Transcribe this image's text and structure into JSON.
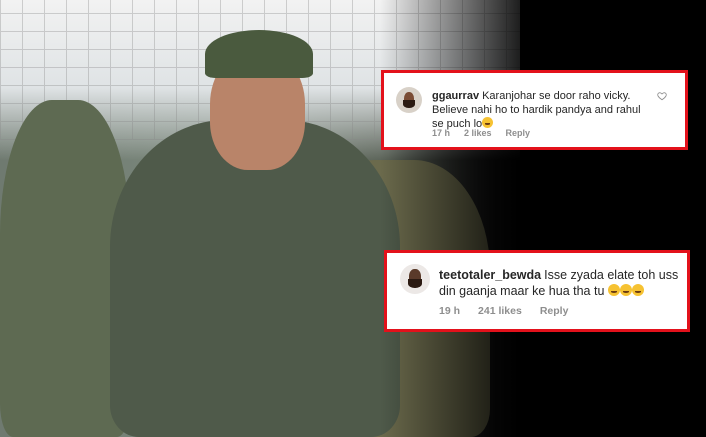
{
  "comments": [
    {
      "username": "ggaurrav",
      "text_line1": "Karanjohar se door raho vicky.",
      "text_line2": "Believe nahi ho to hardik pandya and rahul",
      "text_line3": "se puch lo",
      "emoji": "😝",
      "time": "17 h",
      "likes": "2 likes",
      "reply": "Reply"
    },
    {
      "username": "teetotaler_bewda",
      "text_line1": "Isse zyada elate toh uss",
      "text_line2": "din gaanja maar ke hua tha tu",
      "emoji": "😂😂😂",
      "time": "19 h",
      "likes": "241 likes",
      "reply": "Reply"
    }
  ],
  "colors": {
    "highlight_border": "#e3111b",
    "meta_text": "#8e8e8e"
  },
  "icons": [
    "heart-outline-icon",
    "avatar-photo"
  ]
}
